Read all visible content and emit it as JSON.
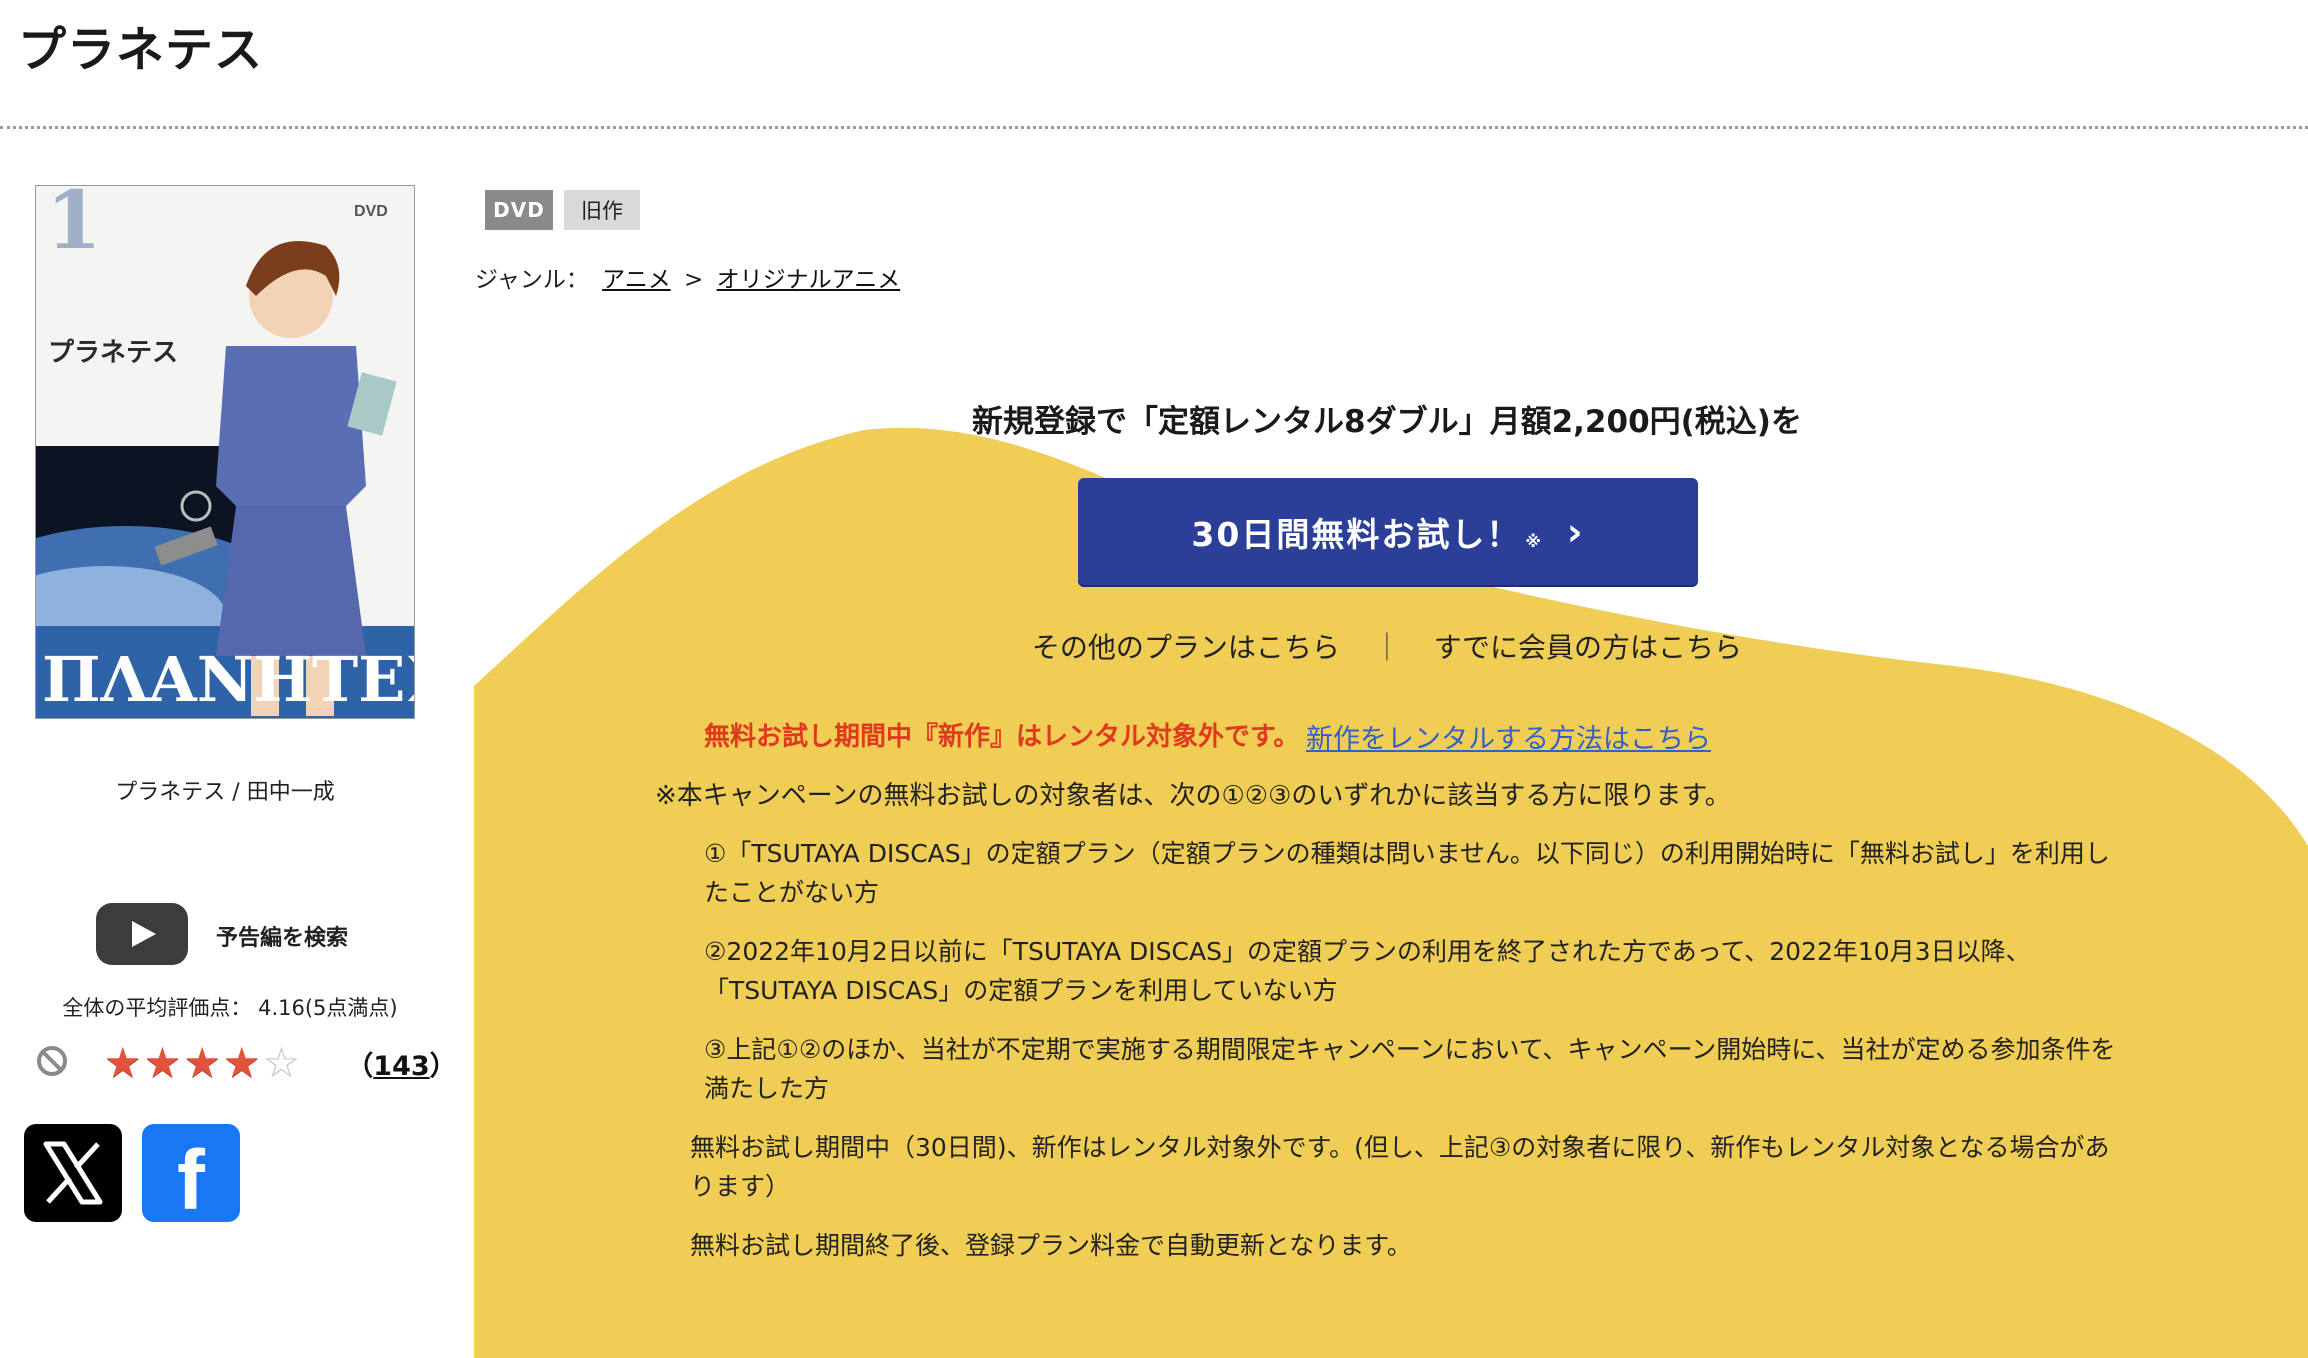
{
  "page": {
    "title": "プラネテス"
  },
  "product": {
    "cover_caption": "プラネテス / 田中一成",
    "cover_texts": {
      "volume": "1",
      "dvd_mark": "DVD",
      "logo": "プラネテス",
      "greek_title": "ΠΛΑΝΗΤΕΣ"
    },
    "badges": [
      "DVD",
      "旧作"
    ],
    "genre": {
      "label": "ジャンル：",
      "items": [
        "アニメ",
        "オリジナルアニメ"
      ],
      "separator": ">"
    }
  },
  "trailer": {
    "label": "予告編を検索",
    "icon": "play-icon"
  },
  "rating": {
    "text": "全体の平均評価点： 4.16(5点満点)",
    "value": 4.16,
    "max": 5,
    "count_display": "143"
  },
  "share": {
    "x_icon": "x-logo-icon",
    "facebook_icon": "facebook-logo-icon",
    "facebook_glyph": "f"
  },
  "campaign": {
    "heading": "新規登録で「定額レンタル8ダブル」月額2,200円(税込)を",
    "cta_label": "30日間無料お試し！",
    "cta_mark": "※",
    "other_plans": "その他のプランはこちら",
    "separator": "｜",
    "members": "すでに会員の方はこちら",
    "notice": "無料お試し期間中『新作』はレンタル対象外です。",
    "notice_link": "新作をレンタルする方法はこちら",
    "terms_intro": "※本キャンペーンの無料お試しの対象者は、次の①②③のいずれかに該当する方に限ります。",
    "terms": [
      "①「TSUTAYA DISCAS」の定額プラン（定額プランの種類は問いません。以下同じ）の利用開始時に「無料お試し」を利用したことがない方",
      "②2022年10月2日以前に「TSUTAYA DISCAS」の定額プランの利用を終了された方であって、2022年10月3日以降、「TSUTAYA DISCAS」の定額プランを利用していない方",
      "③上記①②のほか、当社が不定期で実施する期間限定キャンペーンにおいて、キャンペーン開始時に、当社が定める参加条件を満たした方"
    ],
    "note_1": "無料お試し期間中（30日間)、新作はレンタル対象外です。(但し、上記③の対象者に限り、新作もレンタル対象となる場合があります）",
    "note_2": "無料お試し期間終了後、登録プラン料金で自動更新となります。"
  },
  "colors": {
    "accent_yellow": "#f0cd55",
    "cta_blue": "#2b3f98",
    "notice_red": "#e03a1e",
    "link_blue": "#3560c8",
    "star_red": "#e2533c"
  }
}
